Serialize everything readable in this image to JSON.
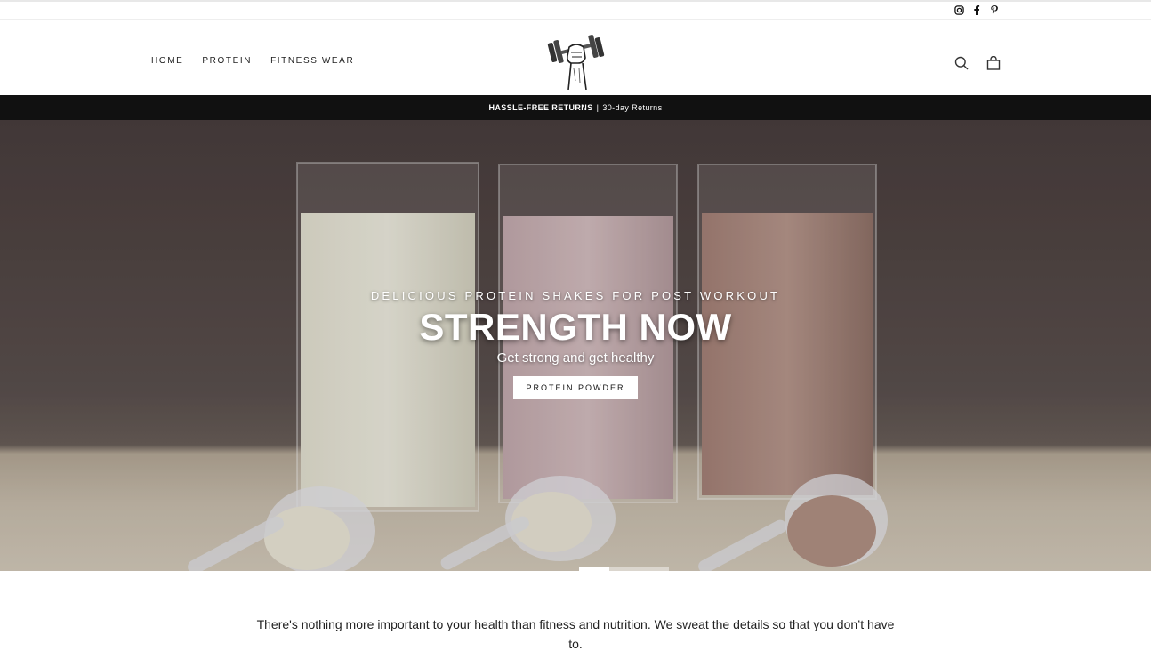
{
  "social": [
    "instagram-icon",
    "facebook-icon",
    "pinterest-icon"
  ],
  "nav": [
    {
      "label": "HOME"
    },
    {
      "label": "PROTEIN"
    },
    {
      "label": "FITNESS WEAR"
    }
  ],
  "header": {
    "logo": "dumbbell-fist-logo",
    "icons": [
      "search-icon",
      "cart-icon"
    ]
  },
  "announcement": {
    "bold": "HASSLE-FREE RETURNS",
    "separator": "|",
    "rest": "30-day Returns"
  },
  "hero": {
    "subtitle": "DELICIOUS PROTEIN SHAKES FOR POST WORKOUT",
    "title": "STRENGTH NOW",
    "tagline": "Get strong and get healthy",
    "button": "PROTEIN POWDER"
  },
  "intro": {
    "text": "There's nothing more important to your health than fitness and nutrition. We sweat the details so that you don’t have to."
  },
  "colors": {
    "announcement_bg": "#111111",
    "button_bg": "#ffffff"
  }
}
